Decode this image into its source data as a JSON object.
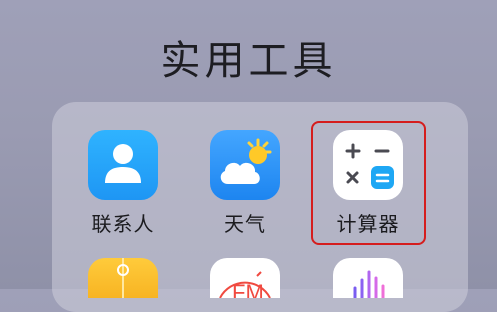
{
  "folder": {
    "title": "实用工具",
    "apps": [
      {
        "label": "联系人",
        "icon": "contacts-icon"
      },
      {
        "label": "天气",
        "icon": "weather-icon"
      },
      {
        "label": "计算器",
        "icon": "calculator-icon"
      }
    ],
    "row2_fm_text": "FM",
    "accent_highlight": "#d51d1d"
  }
}
